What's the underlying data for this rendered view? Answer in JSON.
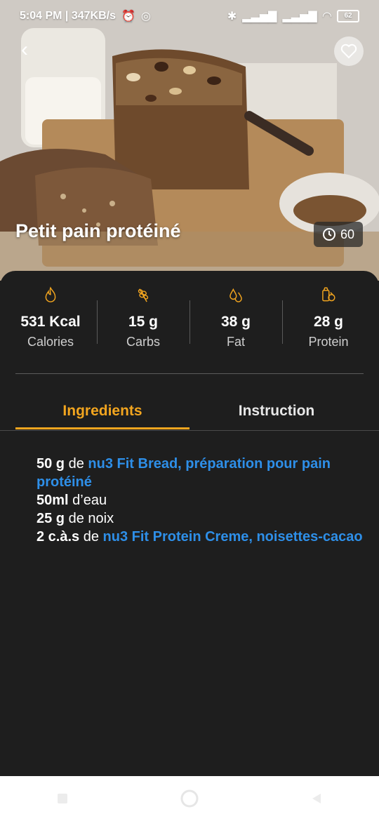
{
  "status_bar": {
    "time_speed": "5:04 PM | 347KB/s",
    "battery": "62"
  },
  "recipe": {
    "title": "Petit pain protéiné",
    "time": "60"
  },
  "macros": [
    {
      "value": "531 Kcal",
      "label": "Calories",
      "icon": "flame-icon"
    },
    {
      "value": "15 g",
      "label": "Carbs",
      "icon": "wheat-icon"
    },
    {
      "value": "38 g",
      "label": "Fat",
      "icon": "droplets-icon"
    },
    {
      "value": "28 g",
      "label": "Protein",
      "icon": "protein-food-icon"
    }
  ],
  "tabs": {
    "ingredients": "Ingredients",
    "instruction": "Instruction"
  },
  "ingredients": [
    {
      "qty": "50 g",
      "mid": " de ",
      "item": "nu3 Fit Bread, préparation pour pain protéiné"
    },
    {
      "qty": "50ml",
      "mid": " d’eau",
      "item": ""
    },
    {
      "qty": "25 g",
      "mid": " de noix",
      "item": ""
    },
    {
      "qty": "2 c.à.s",
      "mid": " de ",
      "item": "nu3 Fit Protein Creme, noisettes-cacao"
    }
  ],
  "colors": {
    "accent": "#f2a51f",
    "link": "#2e8fe8",
    "panel": "#1e1e1e"
  }
}
